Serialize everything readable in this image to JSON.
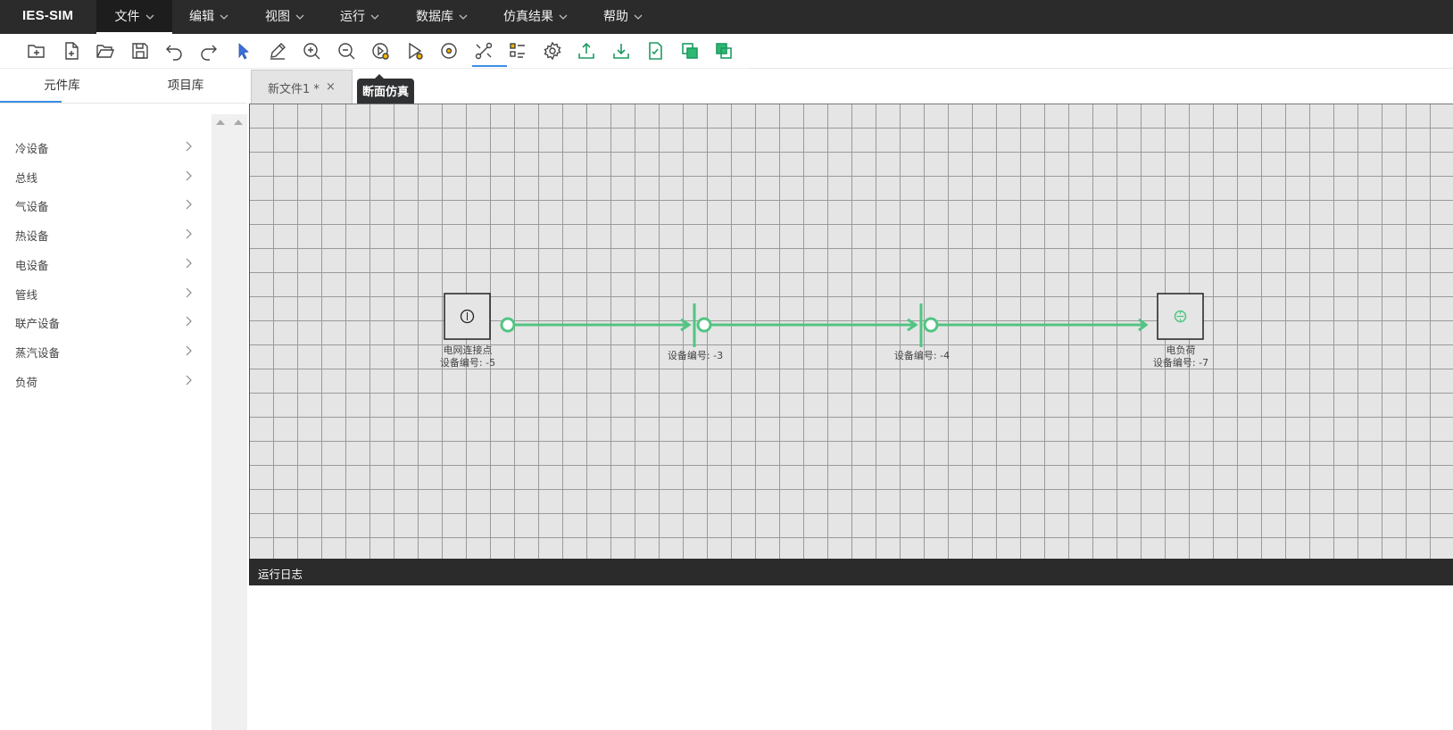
{
  "app": {
    "title": "IES-SIM"
  },
  "menu": [
    {
      "label": "文件"
    },
    {
      "label": "编辑"
    },
    {
      "label": "视图"
    },
    {
      "label": "运行"
    },
    {
      "label": "数据库"
    },
    {
      "label": "仿真结果"
    },
    {
      "label": "帮助"
    }
  ],
  "toolbar": {
    "buttons": [
      "new-folder-icon",
      "new-file-icon",
      "open-folder-icon",
      "save-icon",
      "undo-icon",
      "redo-icon",
      "select-pointer-icon",
      "edit-pen-icon",
      "zoom-in-icon",
      "zoom-out-icon",
      "section-sim-icon",
      "run-pointer-icon",
      "target-icon",
      "connect-icon",
      "checklist-icon",
      "settings-gear-icon",
      "upload-icon",
      "download-icon",
      "verify-doc-icon",
      "copy-layer-icon",
      "layers-icon"
    ],
    "active": "connect-icon",
    "tooltip": "断面仿真",
    "accent_color": "#2eb872"
  },
  "library": {
    "tabs": [
      {
        "label": "元件库"
      },
      {
        "label": "项目库"
      }
    ],
    "categories": [
      {
        "label": "冷设备"
      },
      {
        "label": "总线"
      },
      {
        "label": "气设备"
      },
      {
        "label": "热设备"
      },
      {
        "label": "电设备"
      },
      {
        "label": "管线"
      },
      {
        "label": "联产设备"
      },
      {
        "label": "蒸汽设备"
      },
      {
        "label": "负荷"
      }
    ]
  },
  "file_tab": {
    "label": "新文件1 *",
    "close": "×"
  },
  "diagram": {
    "line_color": "#52c483",
    "nodes": [
      {
        "name": "电网连接点",
        "id_text": "设备编号: -5"
      },
      {
        "name": "",
        "id_text": "设备编号: -3"
      },
      {
        "name": "",
        "id_text": "设备编号: -4"
      },
      {
        "name": "电负荷",
        "id_text": "设备编号: -7"
      }
    ]
  },
  "log": {
    "title": "运行日志"
  }
}
